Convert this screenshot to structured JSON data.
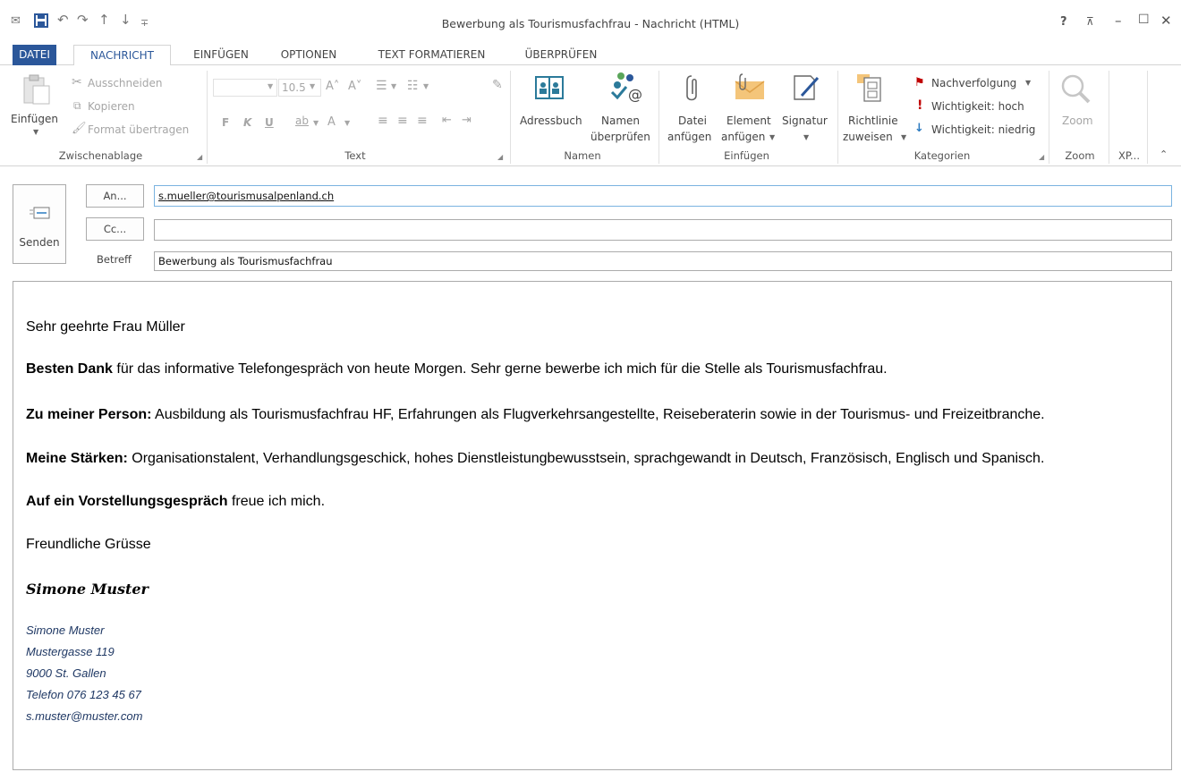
{
  "window": {
    "title": "Bewerbung als Tourismusfachfrau - Nachricht (HTML)",
    "help": "?",
    "ribbon_display": "⊼",
    "minimize": "–",
    "maximize": "☐",
    "close": "✕"
  },
  "quick_access": {
    "app_icon": "✉",
    "save": "💾",
    "undo": "↶",
    "redo": "↷",
    "up": "↑",
    "down": "↓",
    "customize": "∓"
  },
  "tabs": [
    "DATEI",
    "NACHRICHT",
    "EINFÜGEN",
    "OPTIONEN",
    "TEXT FORMATIEREN",
    "ÜBERPRÜFEN"
  ],
  "ribbon": {
    "zwischenablage": {
      "label": "Zwischenablage",
      "paste": "Einfügen",
      "cut": "Ausschneiden",
      "copy": "Kopieren",
      "format": "Format übertragen"
    },
    "text": {
      "label": "Text",
      "font_size": "10.5",
      "bold": "F",
      "italic": "K",
      "underline": "U",
      "grow": "A˄",
      "shrink": "A˅",
      "highlight": "ab",
      "font_color": "A"
    },
    "namen": {
      "label": "Namen",
      "addressbook": "Adressbuch",
      "check_names_1": "Namen",
      "check_names_2": "überprüfen"
    },
    "einfuegen": {
      "label": "Einfügen",
      "attach_file_1": "Datei",
      "attach_file_2": "anfügen",
      "attach_item_1": "Element",
      "attach_item_2": "anfügen",
      "signature": "Signatur"
    },
    "kategorien": {
      "label": "Kategorien",
      "policy_1": "Richtlinie",
      "policy_2": "zuweisen",
      "followup": "Nachverfolgung",
      "importance_high": "Wichtigkeit: hoch",
      "importance_low": "Wichtigkeit: niedrig"
    },
    "zoom": {
      "label": "Zoom",
      "button": "Zoom"
    },
    "xp": {
      "label": "XP..."
    }
  },
  "compose": {
    "send": "Senden",
    "to_button": "An...",
    "cc_button": "Cc...",
    "subject_label": "Betreff",
    "to_value": "s.mueller@tourismusalpenland.ch",
    "cc_value": "",
    "subject_value": "Bewerbung als Tourismusfachfrau"
  },
  "body": {
    "greeting": "Sehr geehrte Frau Müller",
    "p1_bold": "Besten Dank",
    "p1_rest": " für das informative Telefongespräch von heute Morgen. Sehr gerne bewerbe ich mich für die Stelle als Tourismusfachfrau.",
    "p2_bold": "Zu meiner Person:",
    "p2_rest": " Ausbildung als Tourismusfachfrau HF, Erfahrungen als Flugverkehrsangestellte, Reiseberaterin sowie in der Tourismus- und Freizeitbranche.",
    "p3_bold": "Meine Stärken:",
    "p3_rest": " Organisationstalent, Verhandlungsgeschick, hohes Dienstleistungbewusstsein, sprachgewandt in Deutsch, Französisch, Englisch und Spanisch.",
    "p4_bold": "Auf ein Vorstellungsgespräch",
    "p4_rest": " freue ich mich.",
    "closing": "Freundliche Grüsse",
    "signature_script": "Simone Muster",
    "sig_lines": [
      "Simone Muster",
      "Mustergasse 119",
      "9000 St. Gallen",
      "Telefon 076 123 45 67",
      "s.muster@muster.com"
    ]
  },
  "colors": {
    "accent": "#2b579a",
    "signature": "#1f3864",
    "flag_red": "#c00000"
  }
}
